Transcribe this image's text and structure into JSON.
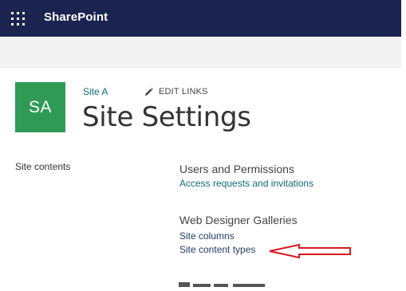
{
  "suite_bar": {
    "brand": "SharePoint",
    "app_launcher_icon": "waffle-grid-icon",
    "background": "#1b2350"
  },
  "site": {
    "logo_initials": "SA",
    "logo_color": "#2f9a56",
    "name": "Site A",
    "edit_links_label": "EDIT LINKS",
    "edit_icon": "pencil-icon"
  },
  "page": {
    "title": "Site Settings"
  },
  "quick_launch": {
    "items": [
      "Site contents"
    ]
  },
  "sections": [
    {
      "heading": "Users and Permissions",
      "links": [
        "Access requests and invitations"
      ]
    },
    {
      "heading": "Web Designer Galleries",
      "links": [
        "Site columns",
        "Site content types"
      ]
    }
  ],
  "annotation": {
    "arrow_icon": "left-pointing-arrow",
    "arrow_color": "#d9181f"
  },
  "colors": {
    "link_teal": "#0f6b7a",
    "link_dark": "#1f3a66"
  }
}
